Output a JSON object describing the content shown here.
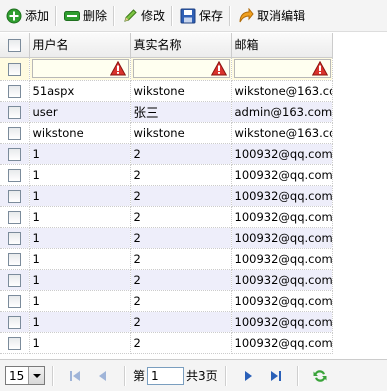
{
  "toolbar": {
    "add": "添加",
    "delete": "删除",
    "edit": "修改",
    "save": "保存",
    "cancel": "取消编辑"
  },
  "grid": {
    "columns": [
      "用户名",
      "真实名称",
      "邮箱"
    ],
    "rows": [
      [
        "51aspx",
        "wikstone",
        "wikstone@163.com"
      ],
      [
        "user",
        "张三",
        "admin@163.com"
      ],
      [
        "wikstone",
        "wikstone",
        "wikstone@163.com"
      ],
      [
        "1",
        "2",
        "100932@qq.com"
      ],
      [
        "1",
        "2",
        "100932@qq.com"
      ],
      [
        "1",
        "2",
        "100932@qq.com"
      ],
      [
        "1",
        "2",
        "100932@qq.com"
      ],
      [
        "1",
        "2",
        "100932@qq.com"
      ],
      [
        "1",
        "2",
        "100932@qq.com"
      ],
      [
        "1",
        "2",
        "100932@qq.com"
      ],
      [
        "1",
        "2",
        "100932@qq.com"
      ],
      [
        "1",
        "2",
        "100932@qq.com"
      ],
      [
        "1",
        "2",
        "100932@qq.com"
      ]
    ]
  },
  "pager": {
    "page_size": "15",
    "page_prefix": "第",
    "current_page": "1",
    "total_pages": "共3页"
  },
  "colors": {
    "alt_row": "#eeeefa",
    "edit_row": "#fffbe0",
    "add_icon": "#2e9e2e",
    "nav_icon": "#2a60b8"
  }
}
